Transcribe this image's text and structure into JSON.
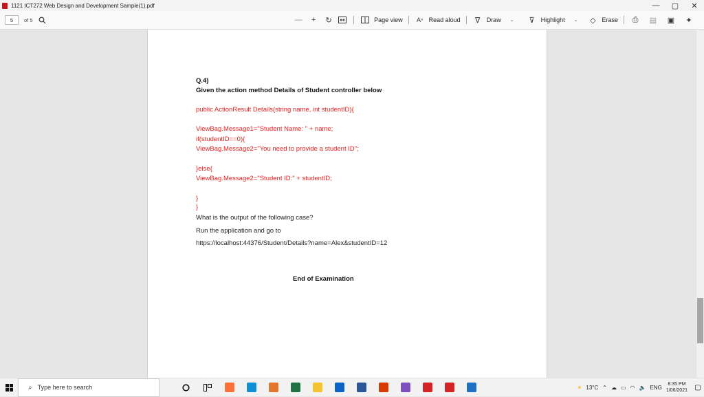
{
  "window": {
    "title": "1121 ICT272 Web Design and Development Sample(1).pdf",
    "controls": {
      "minimize": "—",
      "restore": "▢",
      "close": "✕"
    }
  },
  "toolbar": {
    "page_current": "5",
    "page_total": "of 5",
    "zoom_out": "—",
    "zoom_in": "+",
    "page_view_label": "Page view",
    "read_aloud_label": "Read aloud",
    "draw_label": "Draw",
    "highlight_label": "Highlight",
    "erase_label": "Erase"
  },
  "document": {
    "question": "Q.4)",
    "prompt": "Given the action method Details of Student controller below",
    "code": [
      "public ActionResult Details(string name, int studentID){",
      "ViewBag.Message1=\"Student Name: \" + name;",
      "if(studentID==0){",
      "ViewBag.Message2=\"You need to provide a student ID\";",
      "}else{",
      "ViewBag.Message2=\"Student ID:\" + studentID;",
      "}",
      "}"
    ],
    "question_line": "What is the output of the following case?",
    "instruction": "Run the application and go to",
    "url": "https://localhost:44376/Student/Details?name=Alex&studentID=12",
    "footer": "End of Examination"
  },
  "taskbar": {
    "search_placeholder": "Type here to search",
    "weather": "13°C",
    "language": "ENG",
    "time": "8:35 PM",
    "date": "1/06/2021",
    "apps": [
      {
        "name": "firefox-icon",
        "color": "#ff7139"
      },
      {
        "name": "edge-icon",
        "color": "#0f8fd6"
      },
      {
        "name": "office-icon",
        "color": "#e2762d"
      },
      {
        "name": "excel-icon",
        "color": "#1f7244"
      },
      {
        "name": "files-icon",
        "color": "#f4c430"
      },
      {
        "name": "mail-icon",
        "color": "#0a64c8"
      },
      {
        "name": "word-icon",
        "color": "#2b579a"
      },
      {
        "name": "office365-icon",
        "color": "#d83b01"
      },
      {
        "name": "visualstudio-icon",
        "color": "#7d4fbf"
      },
      {
        "name": "pdf-icon",
        "color": "#d42424"
      },
      {
        "name": "pdf2-icon",
        "color": "#d42424"
      },
      {
        "name": "photos-icon",
        "color": "#1f6fc5"
      }
    ]
  }
}
